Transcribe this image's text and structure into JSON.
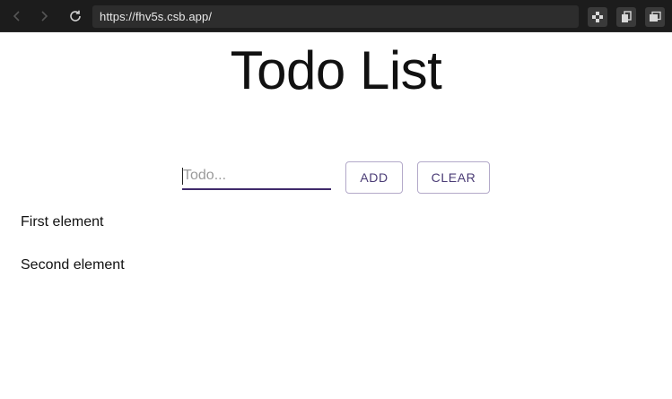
{
  "browser": {
    "url": "https://fhv5s.csb.app/"
  },
  "app": {
    "title": "Todo List",
    "input": {
      "value": "",
      "placeholder": "Todo..."
    },
    "buttons": {
      "add_label": "ADD",
      "clear_label": "CLEAR"
    },
    "todos": [
      "First element",
      "Second element"
    ]
  },
  "colors": {
    "accent": "#4a3b75",
    "button_border": "#b3a9c9",
    "chrome_bg": "#1c1c1c"
  },
  "icons": {
    "back": "chevron-left-icon",
    "forward": "chevron-right-icon",
    "reload": "reload-icon",
    "ext_1": "puzzle-icon",
    "ext_2": "copy-icon",
    "ext_3": "windows-icon"
  }
}
